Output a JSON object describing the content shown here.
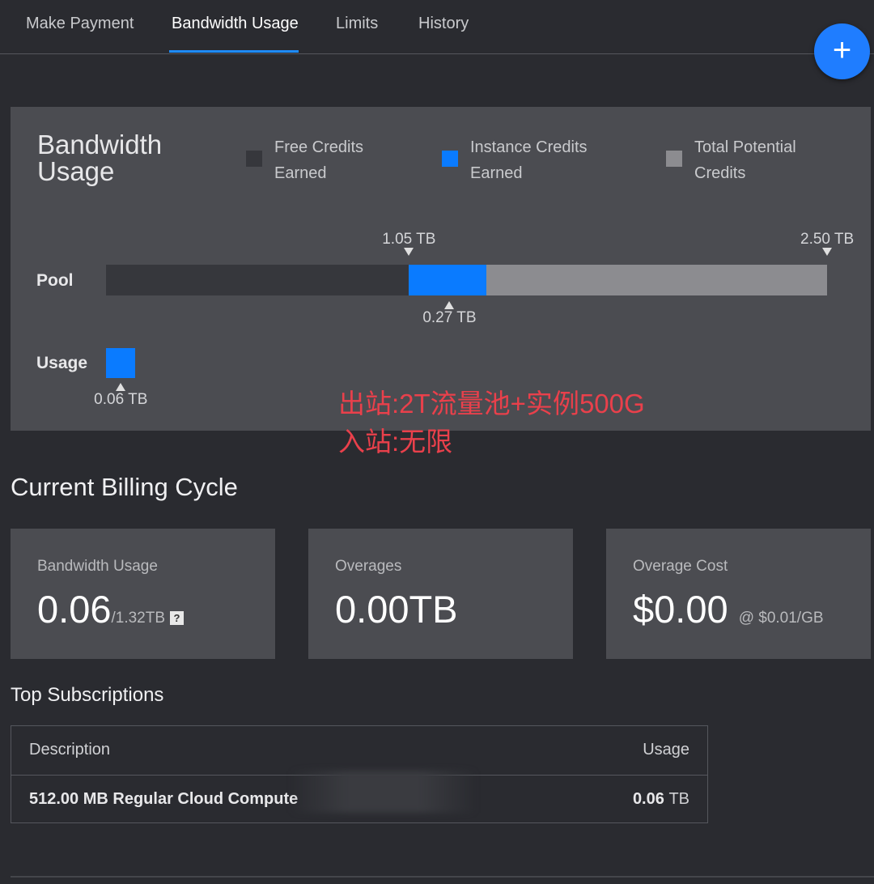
{
  "tabs": [
    {
      "label": "Make Payment"
    },
    {
      "label": "Bandwidth Usage"
    },
    {
      "label": "Limits"
    },
    {
      "label": "History"
    }
  ],
  "fab": {
    "label": "+"
  },
  "usage_panel": {
    "title": "Bandwidth Usage",
    "legend": [
      {
        "label": "Free Credits Earned",
        "color": "#36373c"
      },
      {
        "label": "Instance Credits Earned",
        "color": "#0a7bff"
      },
      {
        "label": "Total Potential Credits",
        "color": "#8c8c90"
      }
    ],
    "pool_label": "Pool",
    "usage_label": "Usage",
    "pool": {
      "free_tb": 1.05,
      "instance_tb": 0.27,
      "total_tb": 2.5,
      "free_marker": "1.05 TB",
      "instance_marker": "0.27 TB",
      "total_marker": "2.50 TB"
    },
    "usage": {
      "value_tb": 0.06,
      "marker": "0.06 TB"
    }
  },
  "annotation": {
    "line1": "出站:2T流量池+实例500G",
    "line2": "入站:无限"
  },
  "billing": {
    "title": "Current Billing Cycle",
    "cards": [
      {
        "label": "Bandwidth Usage",
        "value": "0.06",
        "suffix": "/1.32TB",
        "help": "?"
      },
      {
        "label": "Overages",
        "value": "0.00TB",
        "suffix": ""
      },
      {
        "label": "Overage Cost",
        "value": "$0.00",
        "suffix": "@ $0.01/GB"
      }
    ]
  },
  "subscriptions": {
    "title": "Top Subscriptions",
    "columns": [
      "Description",
      "Usage"
    ],
    "rows": [
      {
        "description": "512.00 MB Regular Cloud Compute",
        "usage_value": "0.06",
        "usage_unit": "TB"
      }
    ]
  }
}
